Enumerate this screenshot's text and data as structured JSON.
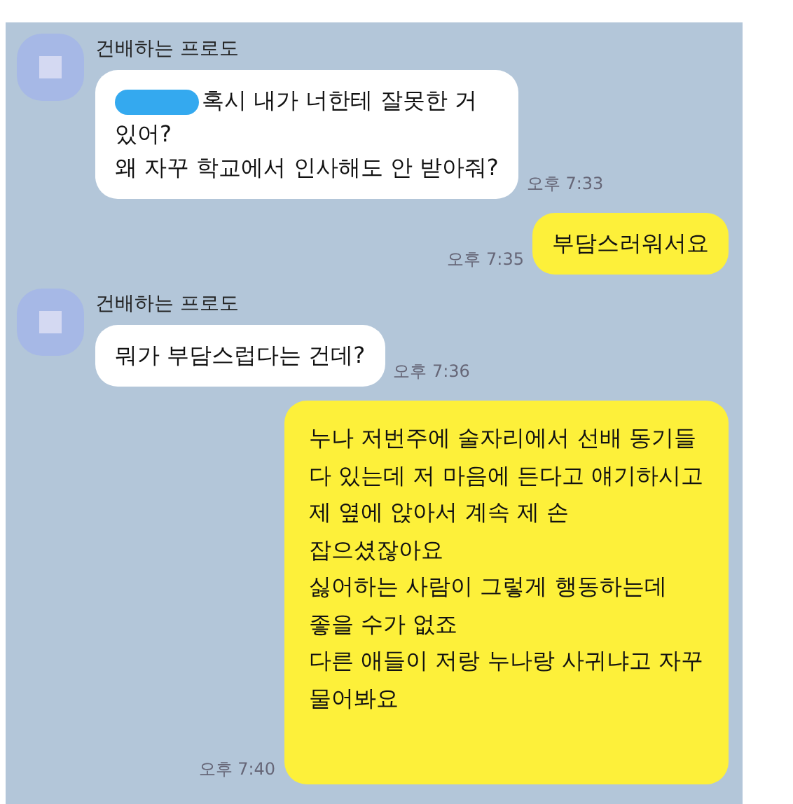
{
  "messages": [
    {
      "kind": "received",
      "sender": "건배하는 프로도",
      "redacted": true,
      "text": "혹시 내가 너한테 잘못한 거\n있어?\n왜 자꾸 학교에서 인사해도 안 받아줘?",
      "time": "오후 7:33"
    },
    {
      "kind": "sent",
      "text": "부담스러워서요",
      "time": "오후 7:35"
    },
    {
      "kind": "received",
      "sender": "건배하는 프로도",
      "redacted": false,
      "text": "뭐가 부담스럽다는 건데?",
      "time": "오후 7:36"
    },
    {
      "kind": "sent",
      "text": "누나 저번주에 술자리에서 선배 동기들\n다 있는데 저 마음에 든다고 얘기하시고\n제 옆에 앉아서 계속 제 손\n잡으셨잖아요\n싫어하는 사람이 그렇게 행동하는데\n좋을 수가 없죠\n다른 애들이 저랑 누나랑 사귀냐고 자꾸\n물어봐요",
      "time": "오후 7:40"
    }
  ]
}
